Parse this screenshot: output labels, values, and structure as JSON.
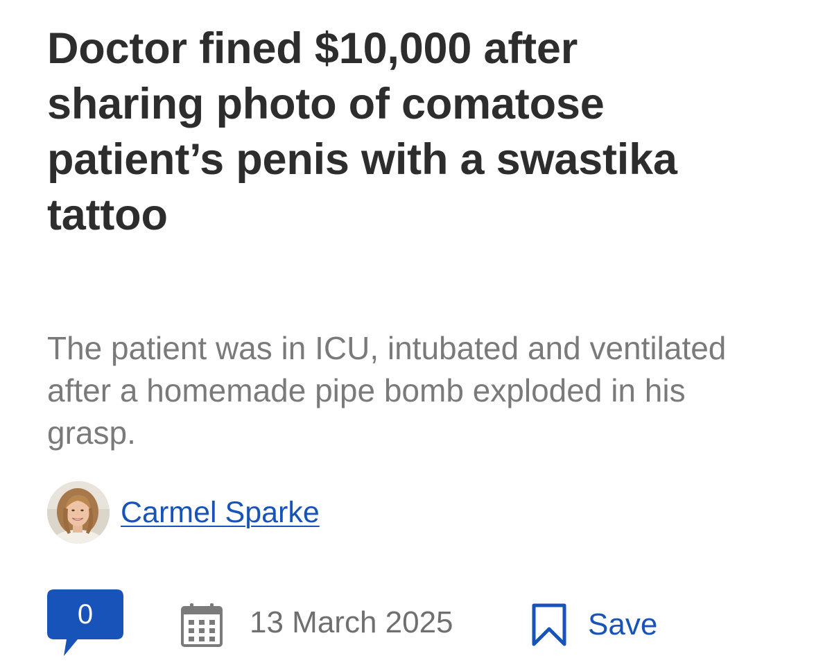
{
  "article": {
    "headline_lines": [
      "Doctor fined $10,000 after",
      "sharing photo of comatose",
      "patient’s penis with a swastika",
      "tattoo"
    ],
    "standfirst_lines": [
      "The patient was in ICU, intubated and ventilated",
      "after a homemade pipe bomb exploded in his",
      "grasp."
    ]
  },
  "byline": {
    "author": "Carmel Sparke",
    "avatar_icon": "author-avatar"
  },
  "meta": {
    "comment_count": "0",
    "comment_icon": "speech-bubble-icon",
    "date_icon": "calendar-icon",
    "date": "13 March 2025",
    "save_icon": "bookmark-icon",
    "save_label": "Save"
  },
  "colors": {
    "headline": "#2d2d2d",
    "standfirst": "#7a7a7a",
    "link_blue": "#1753b8",
    "comment_blue": "#1753b8",
    "date_gray": "#6f6f6f"
  }
}
